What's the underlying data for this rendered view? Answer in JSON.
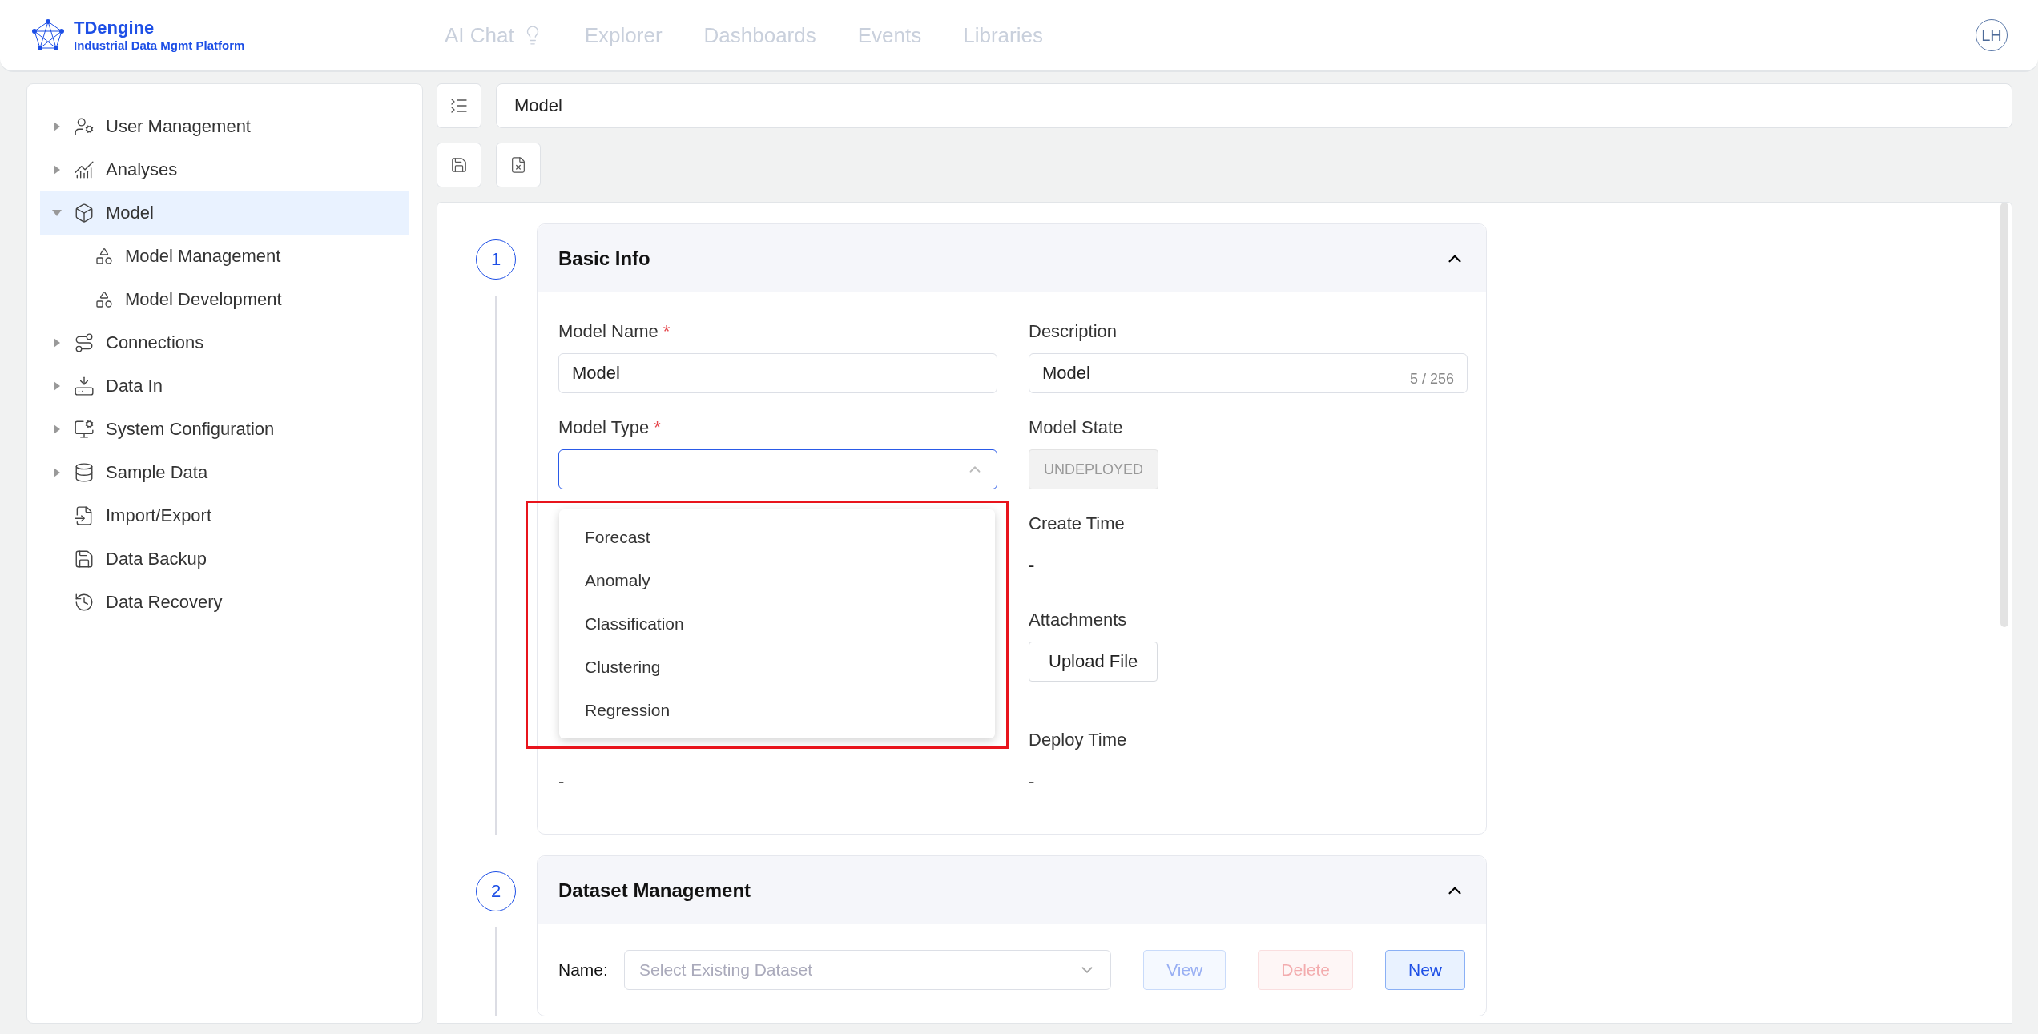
{
  "header": {
    "logo": {
      "name": "TDengine",
      "tagline": "Industrial Data Mgmt Platform"
    },
    "nav": [
      {
        "label": "AI Chat",
        "icon": true
      },
      {
        "label": "Explorer",
        "icon": false
      },
      {
        "label": "Dashboards",
        "icon": false
      },
      {
        "label": "Events",
        "icon": false
      },
      {
        "label": "Libraries",
        "icon": false
      }
    ],
    "avatar": "LH"
  },
  "sidebar": {
    "items": [
      {
        "label": "User Management",
        "kind": "group",
        "expanded": false,
        "selected": false
      },
      {
        "label": "Analyses",
        "kind": "group",
        "expanded": false,
        "selected": false
      },
      {
        "label": "Model",
        "kind": "group",
        "expanded": true,
        "selected": true,
        "children": [
          {
            "label": "Model Management",
            "selected": false
          },
          {
            "label": "Model Development",
            "selected": false
          }
        ]
      },
      {
        "label": "Connections",
        "kind": "group",
        "expanded": false,
        "selected": false
      },
      {
        "label": "Data In",
        "kind": "group",
        "expanded": false,
        "selected": false
      },
      {
        "label": "System Configuration",
        "kind": "group",
        "expanded": false,
        "selected": false
      },
      {
        "label": "Sample Data",
        "kind": "group",
        "expanded": false,
        "selected": false
      },
      {
        "label": "Import/Export",
        "kind": "link",
        "selected": false
      },
      {
        "label": "Data Backup",
        "kind": "link",
        "selected": false
      },
      {
        "label": "Data Recovery",
        "kind": "link",
        "selected": false
      }
    ]
  },
  "title_field": {
    "value": "Model"
  },
  "sections": [
    {
      "step": "1",
      "title": "Basic Info",
      "expanded": true,
      "model_name": {
        "label": "Model Name",
        "required_mark": "*",
        "value": "Model"
      },
      "description": {
        "label": "Description",
        "value": "Model",
        "counter": "5 / 256"
      },
      "model_type": {
        "label": "Model Type",
        "required_mark": "*",
        "open": true,
        "options": [
          {
            "label": "Forecast",
            "selected": false
          },
          {
            "label": "Anomaly",
            "selected": false
          },
          {
            "label": "Classification",
            "selected": false
          },
          {
            "label": "Clustering",
            "selected": false
          },
          {
            "label": "Regression",
            "selected": false
          }
        ]
      },
      "model_state": {
        "label": "Model State",
        "value": "UNDEPLOYED"
      },
      "create_time": {
        "label": "Create Time",
        "value": "-"
      },
      "attachments": {
        "label": "Attachments",
        "button": "Upload File"
      },
      "deploy_name_value": "-",
      "deploy_time": {
        "label": "Deploy Time",
        "value": "-"
      }
    },
    {
      "step": "2",
      "title": "Dataset Management",
      "expanded": true,
      "name_label": "Name:",
      "dataset_placeholder": "Select Existing Dataset",
      "buttons": [
        {
          "label": "View",
          "kind": "primary",
          "disabled": true
        },
        {
          "label": "Delete",
          "kind": "danger",
          "disabled": true
        },
        {
          "label": "New",
          "kind": "primary",
          "disabled": false
        }
      ]
    }
  ],
  "highlight": {
    "color": "#e8141c"
  }
}
